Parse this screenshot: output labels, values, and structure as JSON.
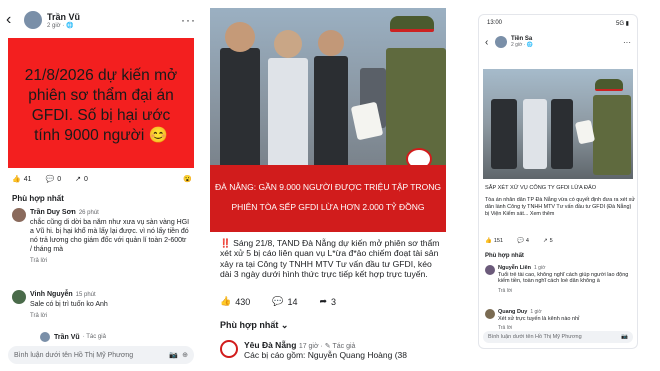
{
  "panel1": {
    "author": "Trần Vũ",
    "time": "2 giờ · 🌐",
    "red_text": "21/8/2026 dự kiến mở phiên sơ thẩm đại án GFDI. Số bị hại ước tính 9000 người 😊",
    "reactions_count": "41",
    "comments_count": "0",
    "shares_count": "0",
    "heading": "Phù hợp nhất",
    "comments": [
      {
        "name": "Trần Duy Sơn",
        "time": "26 phút",
        "text": "chắc cũng di dời ba năm như xưa vụ sàn vàng HGI a Vũ hi. bị hại khổ mà lấy lại được. vì nó lấy tiền đó nó trả lương cho giám đốc với quản lí toàn 2-600tr / tháng mà",
        "reply": "Trả lời"
      },
      {
        "name": "Vinh Nguyễn",
        "time": "15 phút",
        "text": "Sale có bị trì tuốn ko Anh",
        "reply": "Trả lời"
      },
      {
        "name": "Trần Vũ",
        "time": "· Tác giả",
        "text": "",
        "reply": ""
      }
    ],
    "comment_placeholder": "Bình luận dưới tên Hồ Thị Mỹ Phương"
  },
  "panel2": {
    "banner_text": "ĐÀ NẴNG: GẦN 9.000 NGƯỜI ĐƯỢC TRIỆU TẬP TRONG PHIÊN TÒA SẾP GFDI LỪA HƠN 2.000 TỶ ĐỒNG",
    "caption": "‼️ Sáng 21/8, TAND Đà Nẵng dự kiến mở phiên sơ thẩm xét xử 5 bị cáo liên quan vụ L*ừa đ*ảo chiếm đoạt tài sản xảy ra tại Công ty TNHH MTV Tư vấn đầu tư GFDI, kéo dài 3 ngày dưới hình thức trực tiếp kết hợp trực tuyến.",
    "reactions_count": "430",
    "comments_count": "14",
    "shares_count": "3",
    "heading": "Phù hợp nhất",
    "comment_name": "Yêu Đà Nẵng",
    "comment_time": "17 giờ · ✎ Tác giả",
    "comment_text": "Các bị cáo gồm: Nguyễn Quang Hoàng (38"
  },
  "panel3": {
    "clock": "13:00",
    "signal": "5G ▮",
    "author": "Tiền Sa",
    "time": "2 giờ · 🌐",
    "title": "SẮP XÉT XỬ VỤ CÔNG TY GFDI LỪA ĐẢO",
    "body": "Tòa án nhân dân TP Đà Nẵng vừa có quyết định đưa ra xét xử dân lành Công ty TNHH MTV Tư vấn đầu tư GFDI (Đà Nẵng) bị Viện Kiểm sát... Xem thêm",
    "reactions_count": "151",
    "comments_count": "4",
    "shares_count": "5",
    "heading": "Phù hợp nhất",
    "comments": [
      {
        "name": "Nguyễn Liên",
        "time": "1 giờ",
        "text": "Tuổi trẻ tài cao, không nghĩ cách giúp người lao động kiếm tiền, toàn nghĩ cách loè dân không à",
        "reply": "Trả lời"
      },
      {
        "name": "Quang Duy",
        "time": "1 giờ",
        "text": "Xét xử trực tuyến là kênh nào nhỉ",
        "reply": "Trả lời"
      }
    ],
    "comment_placeholder": "Bình luận dưới tên Hồ Thị Mỹ Phương"
  }
}
